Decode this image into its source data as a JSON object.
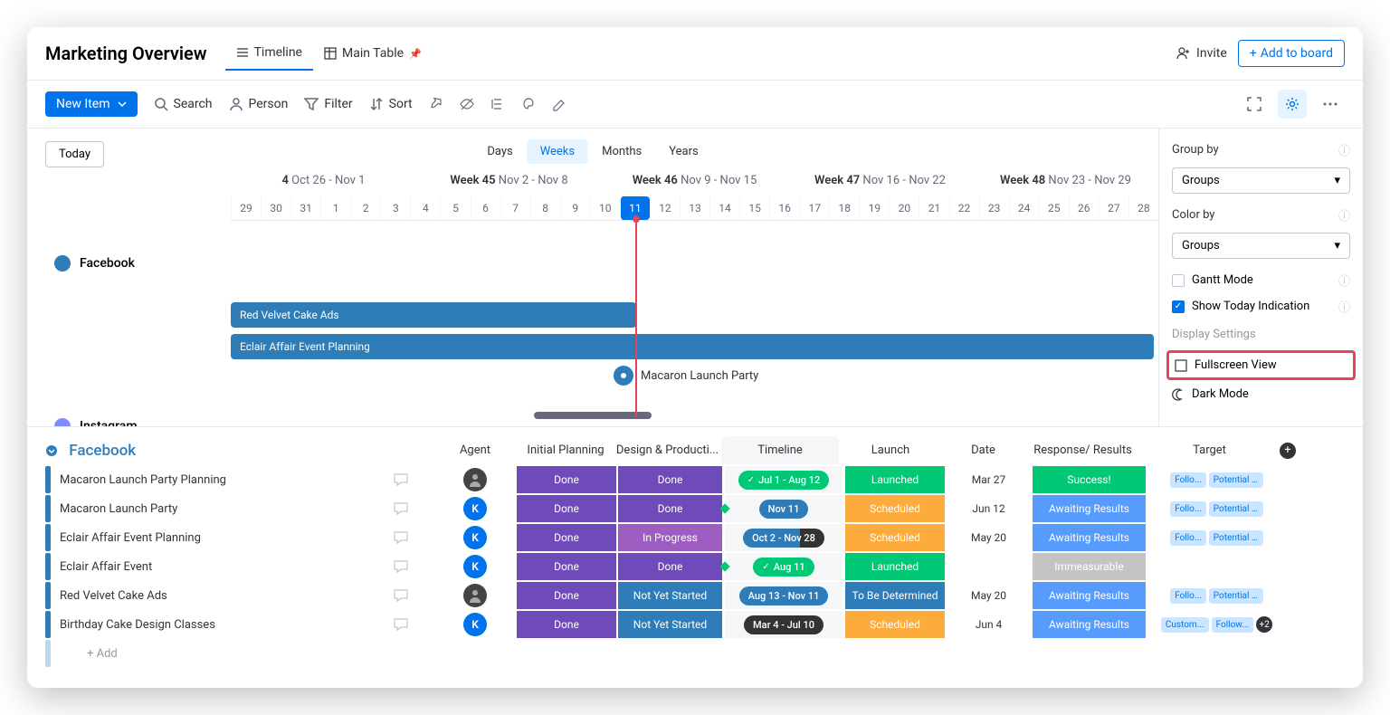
{
  "header": {
    "title": "Marketing Overview",
    "tabs": {
      "timeline": "Timeline",
      "mainTable": "Main Table"
    },
    "invite": "Invite",
    "addToBoard": "Add to board"
  },
  "toolbar": {
    "newItem": "New Item",
    "search": "Search",
    "person": "Person",
    "filter": "Filter",
    "sort": "Sort"
  },
  "timeline": {
    "today": "Today",
    "scales": {
      "days": "Days",
      "weeks": "Weeks",
      "months": "Months",
      "years": "Years"
    },
    "weeks": [
      {
        "label": "4",
        "range": "Oct 26 - Nov 1"
      },
      {
        "label": "Week 45",
        "range": "Nov 2 - Nov 8"
      },
      {
        "label": "Week 46",
        "range": "Nov 9 - Nov 15"
      },
      {
        "label": "Week 47",
        "range": "Nov 16 - Nov 22"
      },
      {
        "label": "Week 48",
        "range": "Nov 23 - Nov 29"
      }
    ],
    "days": [
      "29",
      "30",
      "31",
      "1",
      "2",
      "3",
      "4",
      "5",
      "6",
      "7",
      "8",
      "9",
      "10",
      "11",
      "12",
      "13",
      "14",
      "15",
      "16",
      "17",
      "18",
      "19",
      "20",
      "21",
      "22",
      "23",
      "24",
      "25",
      "26",
      "27",
      "28"
    ],
    "todayIndex": 13,
    "groups": {
      "facebook": "Facebook",
      "instagram": "Instagram"
    },
    "bars": {
      "redVelvet": "Red Velvet Cake Ads",
      "eclair": "Eclair Affair Event Planning",
      "macaron": "Macaron Launch Party"
    }
  },
  "settings": {
    "groupBy": "Group by",
    "groupByValue": "Groups",
    "colorBy": "Color by",
    "colorByValue": "Groups",
    "gantt": "Gantt Mode",
    "showToday": "Show Today Indication",
    "displaySettings": "Display Settings",
    "fullscreen": "Fullscreen View",
    "darkMode": "Dark Mode"
  },
  "table": {
    "groupName": "Facebook",
    "addRow": "+ Add",
    "columns": {
      "agent": "Agent",
      "initialPlanning": "Initial Planning",
      "designProduction": "Design & Producti...",
      "timeline": "Timeline",
      "launch": "Launch",
      "date": "Date",
      "responseResults": "Response/ Results",
      "target": "Target"
    },
    "rows": [
      {
        "name": "Macaron Launch Party Planning",
        "agent": "img",
        "ip": "Done",
        "dp": "Done",
        "tl": "Jul 1 - Aug 12",
        "tlClass": "tl-green",
        "tlCheck": true,
        "launch": "Launched",
        "launchClass": "launched",
        "date": "Mar 27",
        "rr": "Success!",
        "rrClass": "success",
        "targets": [
          "Follo...",
          "Potential Foll..."
        ]
      },
      {
        "name": "Macaron Launch Party",
        "agent": "K",
        "ip": "Done",
        "dp": "Done",
        "tl": "Nov 11",
        "tlClass": "tl-blue",
        "diamond": true,
        "launch": "Scheduled",
        "launchClass": "scheduled",
        "date": "Jun 12",
        "rr": "Awaiting Results",
        "rrClass": "awaiting",
        "targets": [
          "Follo...",
          "Potential Foll..."
        ]
      },
      {
        "name": "Eclair Affair Event Planning",
        "agent": "K",
        "ip": "Done",
        "dp": "In Progress",
        "dpClass": "inprog",
        "tl": "Oct 2 - Nov 28",
        "tlClass": "tl-split",
        "launch": "Scheduled",
        "launchClass": "scheduled",
        "date": "May 20",
        "rr": "Awaiting Results",
        "rrClass": "awaiting",
        "targets": [
          "Follo...",
          "Potential Foll..."
        ]
      },
      {
        "name": "Eclair Affair Event",
        "agent": "K",
        "ip": "Done",
        "dp": "Done",
        "tl": "Aug 11",
        "tlClass": "tl-green",
        "tlCheck": true,
        "diamond": true,
        "launch": "Launched",
        "launchClass": "launched",
        "date": "",
        "rr": "Immeasurable",
        "rrClass": "grey",
        "targets": []
      },
      {
        "name": "Red Velvet Cake Ads",
        "agent": "img",
        "ip": "Done",
        "dp": "Not Yet Started",
        "dpClass": "nys",
        "tl": "Aug 13 - Nov 11",
        "tlClass": "tl-blue",
        "launch": "To Be Determined",
        "launchClass": "tbd",
        "date": "May 20",
        "rr": "Awaiting Results",
        "rrClass": "awaiting",
        "targets": [
          "Follo...",
          "Potential Foll..."
        ]
      },
      {
        "name": "Birthday Cake Design Classes",
        "agent": "K",
        "ip": "Done",
        "dp": "Not Yet Started",
        "dpClass": "nys",
        "tl": "Mar 4 - Jul 10",
        "tlClass": "tl-dark",
        "launch": "Scheduled",
        "launchClass": "scheduled",
        "date": "Jun 4",
        "rr": "Awaiting Results",
        "rrClass": "awaiting",
        "targets": [
          "Custom...",
          "Follow..."
        ],
        "plusCount": "+2"
      }
    ]
  }
}
